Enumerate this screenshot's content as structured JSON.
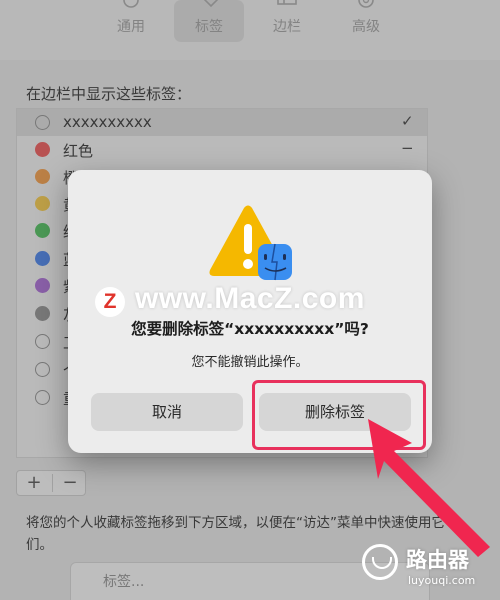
{
  "toolbar": {
    "tabs": [
      {
        "label": "通用",
        "icon": "gear-icon"
      },
      {
        "label": "标签",
        "icon": "tag-icon"
      },
      {
        "label": "边栏",
        "icon": "sidebar-icon"
      },
      {
        "label": "高级",
        "icon": "gear-advanced-icon"
      }
    ],
    "active_tab": "标签"
  },
  "tags_section": {
    "title": "在边栏中显示这些标签：",
    "tags": [
      {
        "name": "xxxxxxxxxx",
        "color": "hollow",
        "selected": true,
        "state": "checked"
      },
      {
        "name": "红色",
        "color": "#ec6a6a",
        "state": "mixed"
      },
      {
        "name": "橙",
        "color": "#f0a45a"
      },
      {
        "name": "黄",
        "color": "#f2cc5c"
      },
      {
        "name": "绿",
        "color": "#61c36e"
      },
      {
        "name": "蓝",
        "color": "#5b8de8"
      },
      {
        "name": "紫",
        "color": "#b07ad6"
      },
      {
        "name": "灰",
        "color": "#9a9a9a"
      },
      {
        "name": "工",
        "color": "hollow"
      },
      {
        "name": "个",
        "color": "hollow"
      },
      {
        "name": "重",
        "color": "hollow"
      }
    ],
    "check_mark": "✓",
    "mixed_mark": "−"
  },
  "list_controls": {
    "add": "+",
    "remove": "−"
  },
  "drop_hint": "将您的个人收藏标签拖移到下方区域，以便在“访达”菜单中快速使用它们。",
  "drop_area_placeholder": "标签...",
  "dialog": {
    "title": "您要删除标签“xxxxxxxxxx”吗?",
    "message": "您不能撤销此操作。",
    "cancel_label": "取消",
    "delete_label": "删除标签"
  },
  "watermark": {
    "logo_letter": "Z",
    "text": "www.MacZ.com"
  },
  "brand": {
    "name": "路由器",
    "url": "luyouqi.com"
  },
  "colors": {
    "highlight": "#e8305c",
    "warning": "#f5b800",
    "finder": "#3a8ef0"
  }
}
